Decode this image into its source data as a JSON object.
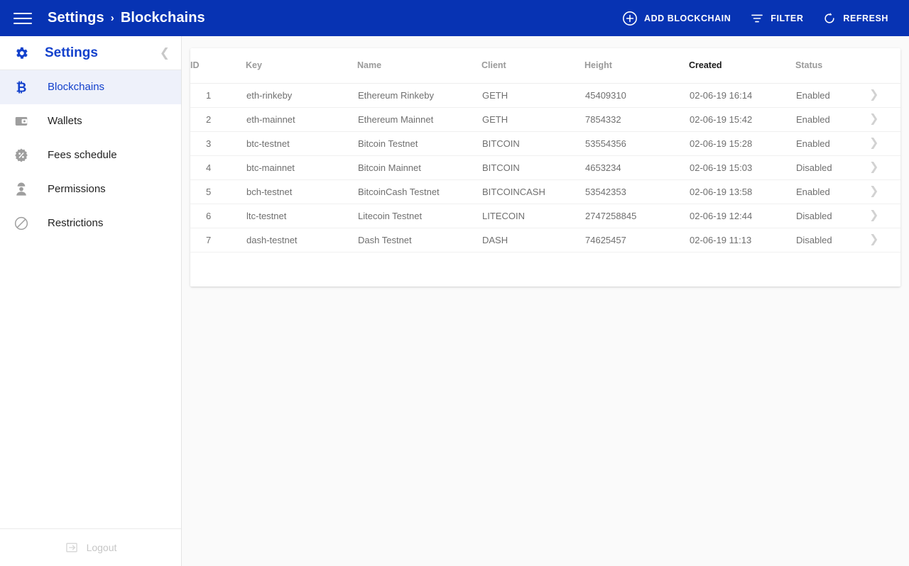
{
  "topbar": {
    "menu_icon": "hamburger-icon",
    "breadcrumb": {
      "parent": "Settings",
      "separator": "›",
      "current": "Blockchains"
    },
    "actions": [
      {
        "id": "add-blockchain",
        "label": "ADD BLOCKCHAIN",
        "icon": "plus-circle-icon"
      },
      {
        "id": "filter",
        "label": "FILTER",
        "icon": "filter-icon"
      },
      {
        "id": "refresh",
        "label": "REFRESH",
        "icon": "refresh-icon"
      }
    ],
    "background_color": "#0733b3",
    "text_color": "#ffffff"
  },
  "sidebar": {
    "title": "Settings",
    "title_icon": "gear-icon",
    "collapse_icon": "chevron-left-icon",
    "items": [
      {
        "label": "Blockchains",
        "icon": "bitcoin-icon",
        "active": true
      },
      {
        "label": "Wallets",
        "icon": "wallet-icon",
        "active": false
      },
      {
        "label": "Fees schedule",
        "icon": "percent-badge-icon",
        "active": false
      },
      {
        "label": "Permissions",
        "icon": "user-hardhat-icon",
        "active": false
      },
      {
        "label": "Restrictions",
        "icon": "block-circle-icon",
        "active": false
      }
    ],
    "logout": {
      "label": "Logout",
      "icon": "logout-icon",
      "disabled": true
    },
    "active_color": "#1341cc",
    "active_background": "#eef1fa"
  },
  "table": {
    "columns": [
      {
        "key": "id",
        "label": "ID",
        "sorted": false
      },
      {
        "key": "key",
        "label": "Key",
        "sorted": false
      },
      {
        "key": "name",
        "label": "Name",
        "sorted": false
      },
      {
        "key": "client",
        "label": "Client",
        "sorted": false
      },
      {
        "key": "height",
        "label": "Height",
        "sorted": false
      },
      {
        "key": "created",
        "label": "Created",
        "sorted": true
      },
      {
        "key": "status",
        "label": "Status",
        "sorted": false
      }
    ],
    "row_chevron_icon": "chevron-right-icon",
    "status_colors": {
      "Enabled": "#22a03f",
      "Disabled": "#ef3b2f"
    },
    "rows": [
      {
        "id": "1",
        "key": "eth-rinkeby",
        "name": "Ethereum Rinkeby",
        "client": "GETH",
        "height": "45409310",
        "created": "02-06-19 16:14",
        "status": "Enabled"
      },
      {
        "id": "2",
        "key": "eth-mainnet",
        "name": "Ethereum Mainnet",
        "client": "GETH",
        "height": "7854332",
        "created": "02-06-19 15:42",
        "status": "Enabled"
      },
      {
        "id": "3",
        "key": "btc-testnet",
        "name": "Bitcoin Testnet",
        "client": "BITCOIN",
        "height": "53554356",
        "created": "02-06-19 15:28",
        "status": "Enabled"
      },
      {
        "id": "4",
        "key": "btc-mainnet",
        "name": "Bitcoin Mainnet",
        "client": "BITCOIN",
        "height": "4653234",
        "created": "02-06-19 15:03",
        "status": "Disabled"
      },
      {
        "id": "5",
        "key": "bch-testnet",
        "name": "BitcoinCash Testnet",
        "client": "BITCOINCASH",
        "height": "53542353",
        "created": "02-06-19 13:58",
        "status": "Enabled"
      },
      {
        "id": "6",
        "key": "ltc-testnet",
        "name": "Litecoin Testnet",
        "client": "LITECOIN",
        "height": "2747258845",
        "created": "02-06-19 12:44",
        "status": "Disabled"
      },
      {
        "id": "7",
        "key": "dash-testnet",
        "name": "Dash Testnet",
        "client": "DASH",
        "height": "74625457",
        "created": "02-06-19 11:13",
        "status": "Disabled"
      }
    ]
  }
}
